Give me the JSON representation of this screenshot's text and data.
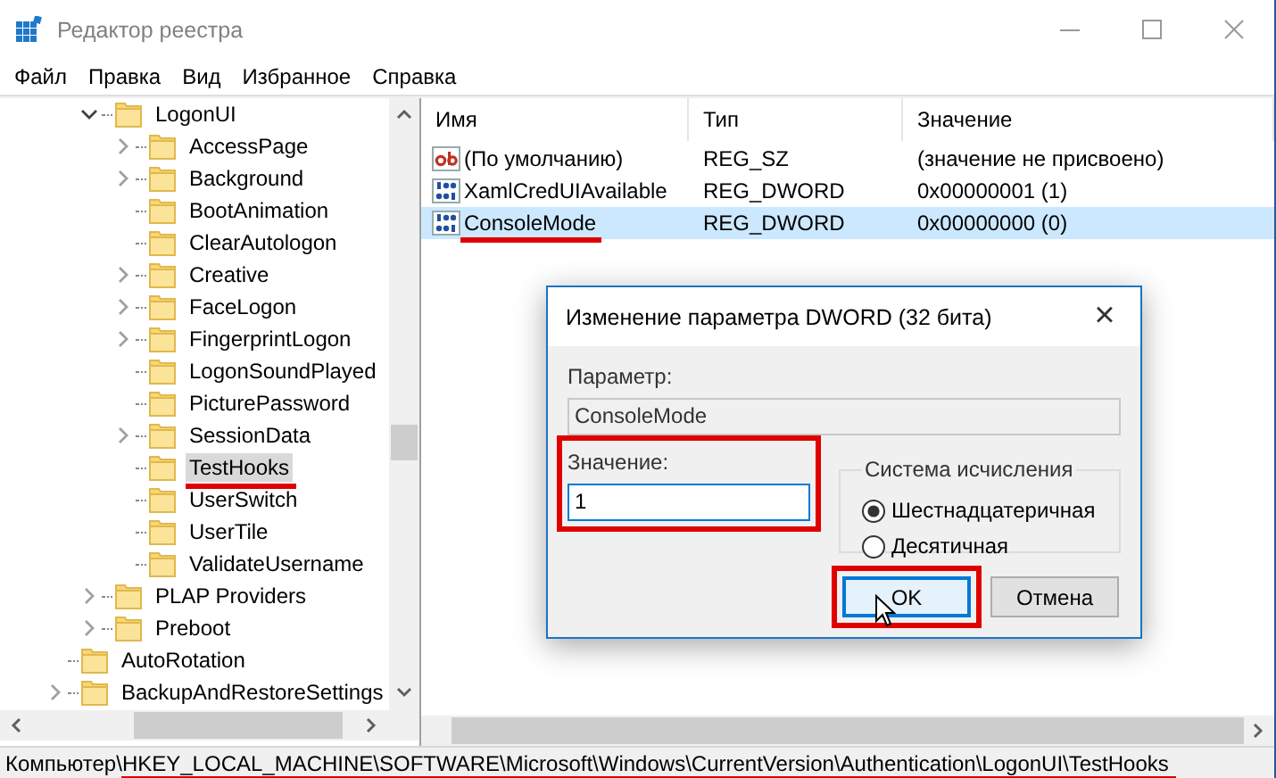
{
  "window": {
    "title": "Редактор реестра"
  },
  "menu": [
    "Файл",
    "Правка",
    "Вид",
    "Избранное",
    "Справка"
  ],
  "tree": {
    "items": [
      {
        "kind": "offscreen",
        "children": [
          {
            "label": "LogonUI",
            "expandable": true,
            "expanded": true,
            "selected": false,
            "children": [
              {
                "label": "AccessPage",
                "expandable": true,
                "selected": false
              },
              {
                "label": "Background",
                "expandable": true,
                "selected": false
              },
              {
                "label": "BootAnimation",
                "expandable": false,
                "selected": false
              },
              {
                "label": "ClearAutologon",
                "expandable": false,
                "selected": false
              },
              {
                "label": "Creative",
                "expandable": true,
                "selected": false
              },
              {
                "label": "FaceLogon",
                "expandable": true,
                "selected": false
              },
              {
                "label": "FingerprintLogon",
                "expandable": true,
                "selected": false
              },
              {
                "label": "LogonSoundPlayed",
                "expandable": false,
                "selected": false
              },
              {
                "label": "PicturePassword",
                "expandable": false,
                "selected": false
              },
              {
                "label": "SessionData",
                "expandable": true,
                "selected": false
              },
              {
                "label": "TestHooks",
                "expandable": false,
                "selected": true,
                "annotated": true
              },
              {
                "label": "UserSwitch",
                "expandable": false,
                "selected": false
              },
              {
                "label": "UserTile",
                "expandable": false,
                "selected": false
              },
              {
                "label": "ValidateUsername",
                "expandable": false,
                "selected": false
              }
            ]
          },
          {
            "label": "PLAP Providers",
            "expandable": true,
            "selected": false
          },
          {
            "label": "Preboot",
            "expandable": true,
            "selected": false
          }
        ]
      },
      {
        "label": "AutoRotation",
        "expandable": false,
        "selected": false
      },
      {
        "label": "BackupAndRestoreSettings",
        "expandable": true,
        "selected": false
      }
    ]
  },
  "values": {
    "columns": [
      "Имя",
      "Тип",
      "Значение"
    ],
    "rows": [
      {
        "kind": "string",
        "name": "(По умолчанию)",
        "type": "REG_SZ",
        "data": "(значение не присвоено)",
        "selected": false
      },
      {
        "kind": "binary",
        "name": "XamlCredUIAvailable",
        "type": "REG_DWORD",
        "data": "0x00000001 (1)",
        "selected": false
      },
      {
        "kind": "binary",
        "name": "ConsoleMode",
        "type": "REG_DWORD",
        "data": "0x00000000 (0)",
        "selected": true,
        "annotated": true
      }
    ]
  },
  "dialog": {
    "title": "Изменение параметра DWORD (32 бита)",
    "close": "×",
    "name_label": "Параметр:",
    "name_value": "ConsoleMode",
    "value_label": "Значение:",
    "value": "1",
    "value_annotated": true,
    "base_group": "Система исчисления",
    "bases": [
      {
        "label": "Шестнадцатеричная",
        "selected": true
      },
      {
        "label": "Десятичная",
        "selected": false
      }
    ],
    "buttons": [
      {
        "label": "OK",
        "default": true,
        "annotated": true
      },
      {
        "label": "Отмена",
        "default": false
      }
    ]
  },
  "status_bar": {
    "prefix": "Компьютер\\",
    "path": "HKEY_LOCAL_MACHINE\\SOFTWARE\\Microsoft\\Windows\\CurrentVersion\\Authentication\\LogonUI\\TestHooks",
    "path_annotated": true
  }
}
